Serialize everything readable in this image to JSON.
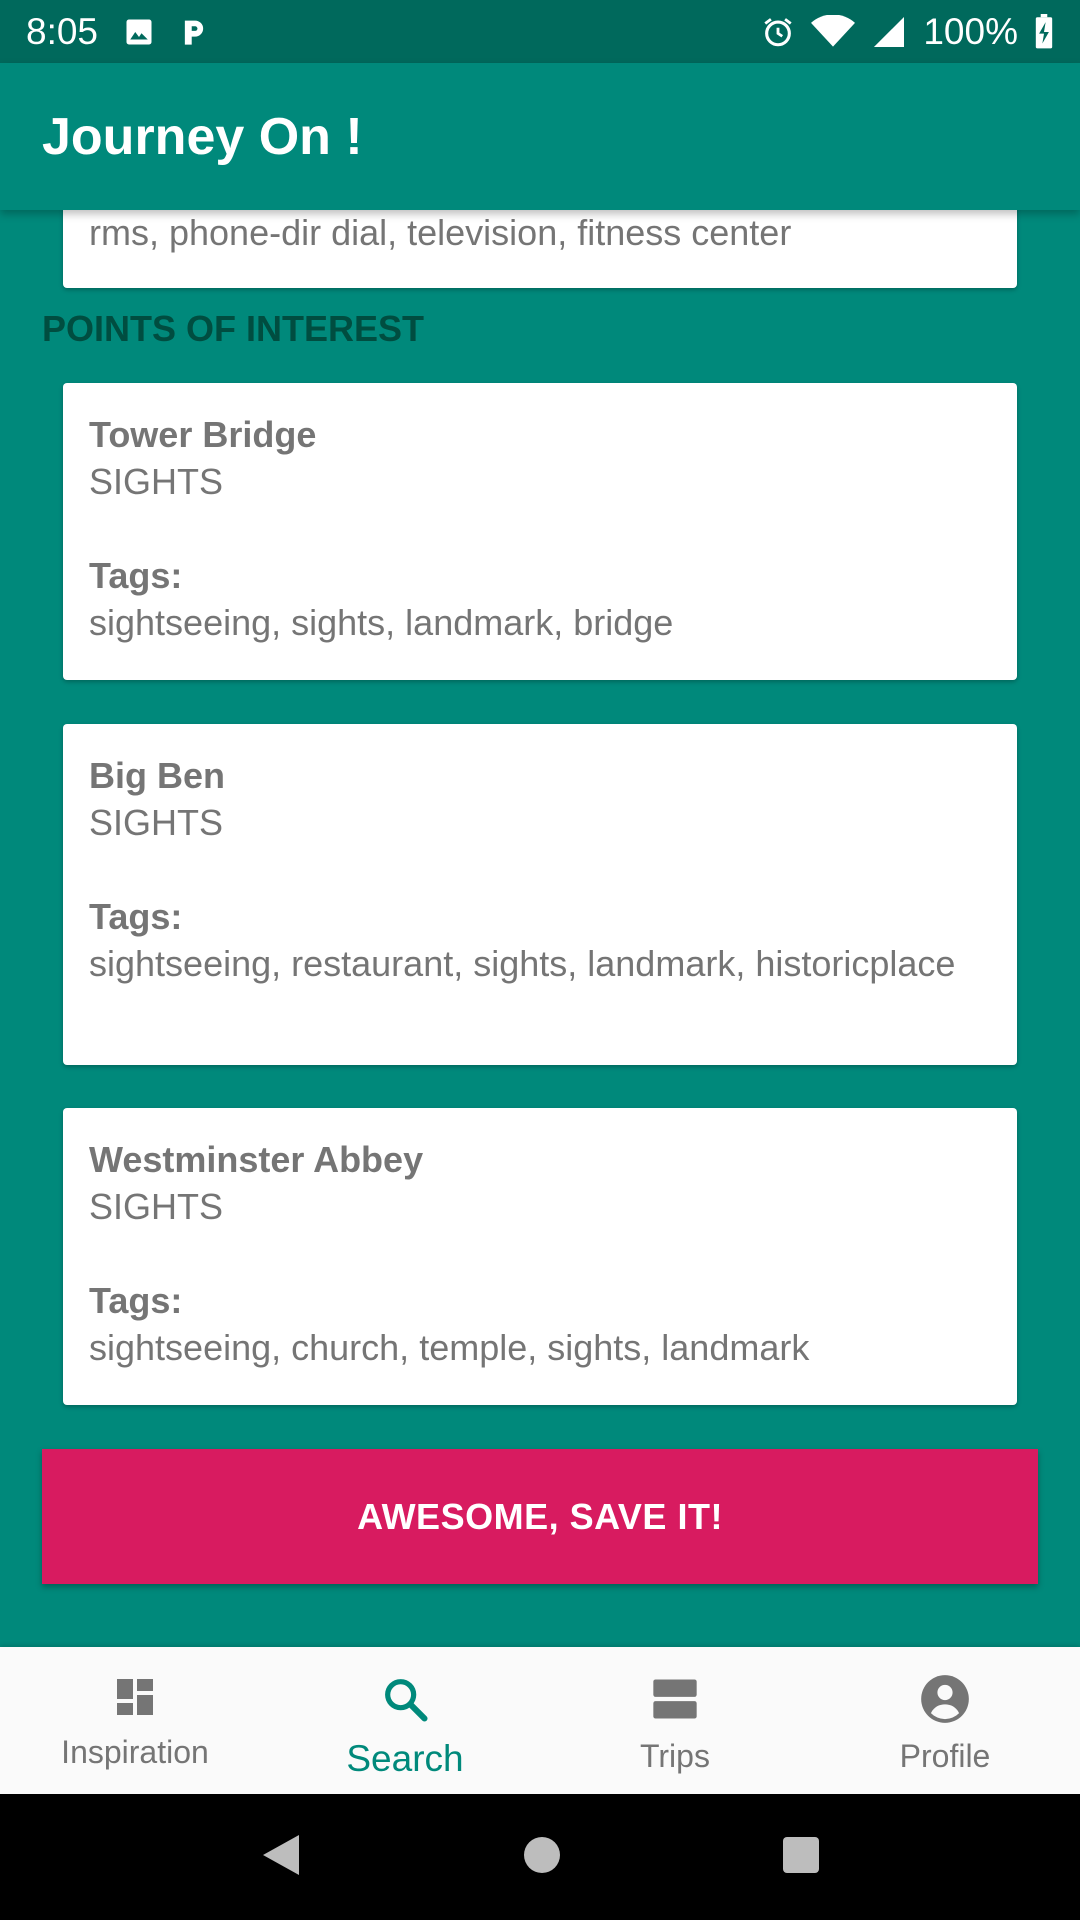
{
  "status_bar": {
    "time": "8:05",
    "battery": "100%",
    "icons": [
      "image-icon",
      "parking-icon",
      "alarm-icon",
      "wifi-icon",
      "signal-icon",
      "battery-charging-icon"
    ]
  },
  "app_bar": {
    "title": "Journey On !"
  },
  "amenities_card": {
    "text": "rms, phone-dir dial, television, fitness center"
  },
  "section": {
    "title": "POINTS OF INTEREST"
  },
  "points_of_interest": [
    {
      "name": "Tower Bridge",
      "category": "SIGHTS",
      "tags_label": "Tags:",
      "tags": "sightseeing, sights, landmark, bridge"
    },
    {
      "name": "Big Ben",
      "category": "SIGHTS",
      "tags_label": "Tags:",
      "tags": "sightseeing, restaurant, sights, landmark, historicplace"
    },
    {
      "name": "Westminster Abbey",
      "category": "SIGHTS",
      "tags_label": "Tags:",
      "tags": "sightseeing, church, temple, sights, landmark"
    }
  ],
  "save_button": {
    "label": "AWESOME, SAVE IT!"
  },
  "bottom_nav": {
    "items": [
      {
        "label": "Inspiration",
        "icon": "dashboard-icon",
        "active": false
      },
      {
        "label": "Search",
        "icon": "search-icon",
        "active": true
      },
      {
        "label": "Trips",
        "icon": "trips-icon",
        "active": false
      },
      {
        "label": "Profile",
        "icon": "profile-icon",
        "active": false
      }
    ]
  },
  "colors": {
    "primary": "#00897b",
    "primary_dark": "#00695c",
    "accent": "#d81b60",
    "section_title": "#004d40"
  }
}
